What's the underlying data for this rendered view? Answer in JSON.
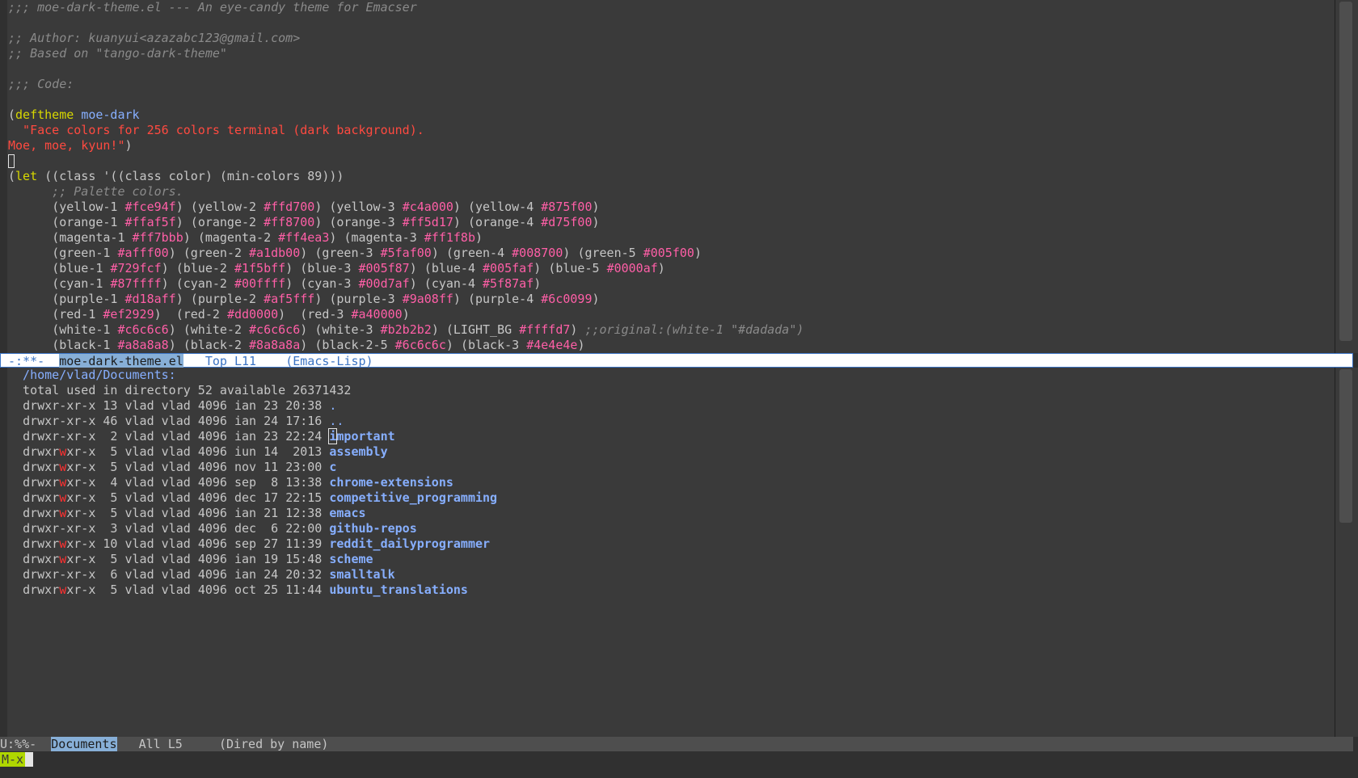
{
  "editor": {
    "header": [
      ";;; moe-dark-theme.el --- An eye-candy theme for Emacser",
      "",
      ";; Author: kuanyui<azazabc123@gmail.com>",
      ";; Based on \"tango-dark-theme\"",
      "",
      ";;; Code:",
      ""
    ],
    "deftheme_kw": "deftheme",
    "deftheme_name": "moe-dark",
    "docstring_1": "  \"Face colors for 256 colors terminal (dark background).",
    "docstring_2": "Moe, moe, kyun!\"",
    "let_kw": "let",
    "let_rest": " ((class '((class color) (min-colors 89)))",
    "palette_comment": "      ;; Palette colors.",
    "palette": [
      [
        [
          "yellow-1",
          "#fce94f"
        ],
        [
          "yellow-2",
          "#ffd700"
        ],
        [
          "yellow-3",
          "#c4a000"
        ],
        [
          "yellow-4",
          "#875f00"
        ]
      ],
      [
        [
          "orange-1",
          "#ffaf5f"
        ],
        [
          "orange-2",
          "#ff8700"
        ],
        [
          "orange-3",
          "#ff5d17"
        ],
        [
          "orange-4",
          "#d75f00"
        ]
      ],
      [
        [
          "magenta-1",
          "#ff7bbb"
        ],
        [
          "magenta-2",
          "#ff4ea3"
        ],
        [
          "magenta-3",
          "#ff1f8b"
        ]
      ],
      [
        [
          "green-1",
          "#afff00"
        ],
        [
          "green-2",
          "#a1db00"
        ],
        [
          "green-3",
          "#5faf00"
        ],
        [
          "green-4",
          "#008700"
        ],
        [
          "green-5",
          "#005f00"
        ]
      ],
      [
        [
          "blue-1",
          "#729fcf"
        ],
        [
          "blue-2",
          "#1f5bff"
        ],
        [
          "blue-3",
          "#005f87"
        ],
        [
          "blue-4",
          "#005faf"
        ],
        [
          "blue-5",
          "#0000af"
        ]
      ],
      [
        [
          "cyan-1",
          "#87ffff"
        ],
        [
          "cyan-2",
          "#00ffff"
        ],
        [
          "cyan-3",
          "#00d7af"
        ],
        [
          "cyan-4",
          "#5f87af"
        ]
      ],
      [
        [
          "purple-1",
          "#d18aff"
        ],
        [
          "purple-2",
          "#af5fff"
        ],
        [
          "purple-3",
          "#9a08ff"
        ],
        [
          "purple-4",
          "#6c0099"
        ]
      ],
      [
        [
          "red-1",
          "#ef2929"
        ],
        [
          "red-2",
          "#dd0000"
        ],
        [
          "red-3",
          "#a40000"
        ]
      ],
      [
        [
          "white-1",
          "#c6c6c6"
        ],
        [
          "white-2",
          "#c6c6c6"
        ],
        [
          "white-3",
          "#b2b2b2"
        ],
        [
          "LIGHT_BG",
          "#ffffd7"
        ]
      ],
      [
        [
          "black-1",
          "#a8a8a8"
        ],
        [
          "black-2",
          "#8a8a8a"
        ],
        [
          "black-2-5",
          "#6c6c6c"
        ],
        [
          "black-3",
          "#4e4e4e"
        ]
      ]
    ],
    "palette_separators": [
      [
        " ",
        " ",
        " "
      ],
      [
        " ",
        " ",
        " "
      ],
      [
        " ",
        " "
      ],
      [
        " ",
        " ",
        " ",
        " "
      ],
      [
        " ",
        " ",
        " ",
        " "
      ],
      [
        " ",
        " ",
        " "
      ],
      [
        " ",
        " ",
        " "
      ],
      [
        "  ",
        "  "
      ],
      [
        " ",
        " ",
        " "
      ],
      [
        " ",
        " ",
        " "
      ]
    ],
    "white_row_comment": " ;;original:(white-1 \"#dadada\")"
  },
  "modeline_top": {
    "status": " -:**-  ",
    "buffer": "moe-dark-theme.el",
    "position": "   Top L11    ",
    "mode": "(Emacs-Lisp)"
  },
  "dired": {
    "path": "  /home/vlad/Documents:",
    "total": "  total used in directory 52 available 26371432",
    "entries": [
      {
        "perm_a": "drwxr-",
        "perm_w": "",
        "perm_b": "xr-x",
        "links": "13",
        "user": "vlad",
        "group": "vlad",
        "size": "4096",
        "month": "ian",
        "day": "23",
        "time": "20:38",
        "name": "."
      },
      {
        "perm_a": "drwxr-",
        "perm_w": "",
        "perm_b": "xr-x",
        "links": "46",
        "user": "vlad",
        "group": "vlad",
        "size": "4096",
        "month": "ian",
        "day": "24",
        "time": "17:16",
        "name": ".."
      },
      {
        "perm_a": "drwxr-",
        "perm_w": "",
        "perm_b": "xr-x",
        "links": " 2",
        "user": "vlad",
        "group": "vlad",
        "size": "4096",
        "month": "ian",
        "day": "23",
        "time": "22:24",
        "name": "important"
      },
      {
        "perm_a": "drwxr",
        "perm_w": "w",
        "perm_b": "xr-x",
        "links": " 5",
        "user": "vlad",
        "group": "vlad",
        "size": "4096",
        "month": "iun",
        "day": "14",
        "time": " 2013",
        "name": "assembly"
      },
      {
        "perm_a": "drwxr",
        "perm_w": "w",
        "perm_b": "xr-x",
        "links": " 5",
        "user": "vlad",
        "group": "vlad",
        "size": "4096",
        "month": "nov",
        "day": "11",
        "time": "23:00",
        "name": "c"
      },
      {
        "perm_a": "drwxr",
        "perm_w": "w",
        "perm_b": "xr-x",
        "links": " 4",
        "user": "vlad",
        "group": "vlad",
        "size": "4096",
        "month": "sep",
        "day": " 8",
        "time": "13:38",
        "name": "chrome-extensions"
      },
      {
        "perm_a": "drwxr",
        "perm_w": "w",
        "perm_b": "xr-x",
        "links": " 5",
        "user": "vlad",
        "group": "vlad",
        "size": "4096",
        "month": "dec",
        "day": "17",
        "time": "22:15",
        "name": "competitive_programming"
      },
      {
        "perm_a": "drwxr",
        "perm_w": "w",
        "perm_b": "xr-x",
        "links": " 5",
        "user": "vlad",
        "group": "vlad",
        "size": "4096",
        "month": "ian",
        "day": "21",
        "time": "12:38",
        "name": "emacs"
      },
      {
        "perm_a": "drwxr-",
        "perm_w": "",
        "perm_b": "xr-x",
        "links": " 3",
        "user": "vlad",
        "group": "vlad",
        "size": "4096",
        "month": "dec",
        "day": " 6",
        "time": "22:00",
        "name": "github-repos"
      },
      {
        "perm_a": "drwxr",
        "perm_w": "w",
        "perm_b": "xr-x",
        "links": "10",
        "user": "vlad",
        "group": "vlad",
        "size": "4096",
        "month": "sep",
        "day": "27",
        "time": "11:39",
        "name": "reddit_dailyprogrammer"
      },
      {
        "perm_a": "drwxr",
        "perm_w": "w",
        "perm_b": "xr-x",
        "links": " 5",
        "user": "vlad",
        "group": "vlad",
        "size": "4096",
        "month": "ian",
        "day": "19",
        "time": "15:48",
        "name": "scheme"
      },
      {
        "perm_a": "drwxr-",
        "perm_w": "",
        "perm_b": "xr-x",
        "links": " 6",
        "user": "vlad",
        "group": "vlad",
        "size": "4096",
        "month": "ian",
        "day": "24",
        "time": "20:32",
        "name": "smalltalk"
      },
      {
        "perm_a": "drwxr",
        "perm_w": "w",
        "perm_b": "xr-x",
        "links": " 5",
        "user": "vlad",
        "group": "vlad",
        "size": "4096",
        "month": "oct",
        "day": "25",
        "time": "11:44",
        "name": "ubuntu_translations"
      }
    ]
  },
  "modeline_bottom": {
    "status": "U:%%-  ",
    "buffer": "Documents",
    "position": "   All L5     ",
    "mode": "(Dired by name)"
  },
  "minibuffer": {
    "prompt": "M-x"
  },
  "colors": {
    "background": "#3a3a3a",
    "foreground": "#c6c6c6",
    "keyword": "#d7d700",
    "function_name": "#87afff",
    "string": "#ff4a40",
    "color_literal": "#ff5fa7",
    "comment": "#8a8a8a",
    "modeline_accent": "#87afd7",
    "minibuffer_prompt_bg": "#afd700"
  }
}
